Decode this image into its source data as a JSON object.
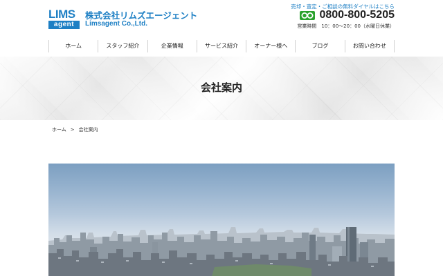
{
  "logo": {
    "top": "LIMS",
    "bottom": "agent"
  },
  "company": {
    "name_jp": "株式会社リムズエージェント",
    "name_en": "Limsagent Co.,Ltd."
  },
  "contact": {
    "note": "売却・査定・ご相談の無料ダイヤルはこちら",
    "phone": "0800-800-5205",
    "hours": "営業時間　10：00〜20：00（水曜日休業）",
    "freedial_icon": "freedial-icon"
  },
  "nav": {
    "items": [
      {
        "label": "ホーム"
      },
      {
        "label": "スタッフ紹介"
      },
      {
        "label": "企業情報"
      },
      {
        "label": "サービス紹介"
      },
      {
        "label": "オーナー様へ"
      },
      {
        "label": "ブログ"
      },
      {
        "label": "お問い合わせ"
      }
    ]
  },
  "hero": {
    "title": "会社案内"
  },
  "breadcrumb": {
    "home": "ホーム",
    "separator": ">",
    "current": "会社案内"
  },
  "colors": {
    "brand": "#1d7fc4",
    "freedial": "#2aa22d",
    "text": "#222222"
  }
}
